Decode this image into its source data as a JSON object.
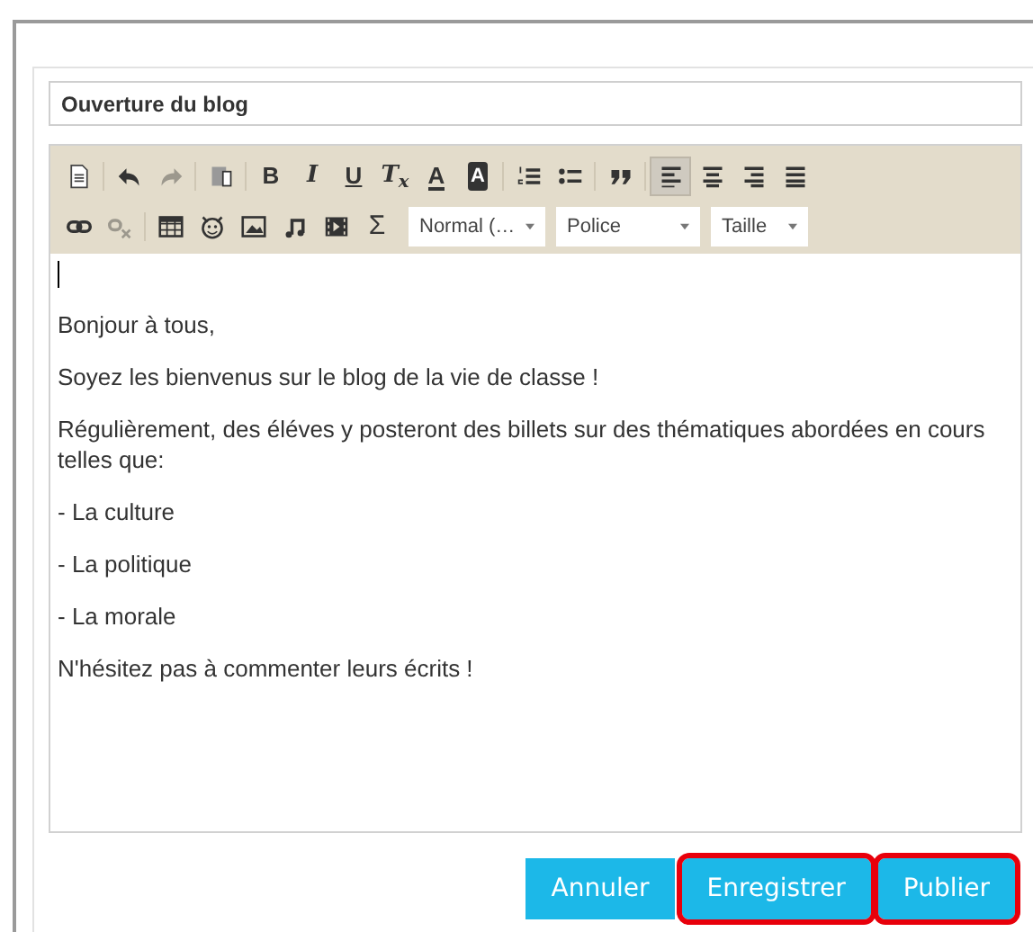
{
  "title_field": {
    "value": "Ouverture du blog"
  },
  "toolbar": {
    "top_row": [
      {
        "kind": "source"
      },
      {
        "kind": "sep"
      },
      {
        "kind": "undo",
        "disabled": false
      },
      {
        "kind": "redo",
        "disabled": true
      },
      {
        "kind": "sep"
      },
      {
        "kind": "paste"
      },
      {
        "kind": "sep"
      },
      {
        "kind": "bold",
        "label": "B"
      },
      {
        "kind": "italic",
        "label": "I"
      },
      {
        "kind": "underline",
        "label": "U"
      },
      {
        "kind": "clearformat",
        "label": "T$_{x}$"
      },
      {
        "kind": "textcolor",
        "label": "A"
      },
      {
        "kind": "bgcolor",
        "label": "A"
      },
      {
        "kind": "sep"
      },
      {
        "kind": "numlist"
      },
      {
        "kind": "bulletlist"
      },
      {
        "kind": "sep"
      },
      {
        "kind": "quote"
      },
      {
        "kind": "sep"
      },
      {
        "kind": "alignleft",
        "selected": true
      },
      {
        "kind": "aligncenter",
        "selected": false
      },
      {
        "kind": "alignright",
        "selected": false
      },
      {
        "kind": "justify",
        "selected": false
      }
    ],
    "bottom_row": [
      {
        "kind": "link",
        "disabled": false
      },
      {
        "kind": "unlink",
        "disabled": true
      },
      {
        "kind": "sep"
      },
      {
        "kind": "table"
      },
      {
        "kind": "smiley"
      },
      {
        "kind": "image"
      },
      {
        "kind": "audio"
      },
      {
        "kind": "video"
      },
      {
        "kind": "sigma",
        "label": "Σ"
      },
      {
        "kind": "dropdown",
        "label": "Normal (…"
      },
      {
        "kind": "dropdown",
        "label": "Police"
      },
      {
        "kind": "dropdown",
        "label": "Taille"
      }
    ]
  },
  "content": {
    "cursor": true,
    "paragraphs": [
      "Bonjour à tous,",
      "Soyez les bienvenus sur le blog de la vie de classe !",
      "Régulièrement, des éléves y posteront des billets sur des thématiques abordées en cours telles que:",
      "- La culture",
      "- La politique",
      "- La morale",
      "N'hésitez pas à commenter leurs écrits !"
    ]
  },
  "buttons": [
    {
      "label": "Annuler",
      "highlighted": false
    },
    {
      "label": "Enregistrer",
      "highlighted": true
    },
    {
      "label": "Publier",
      "highlighted": true
    }
  ]
}
